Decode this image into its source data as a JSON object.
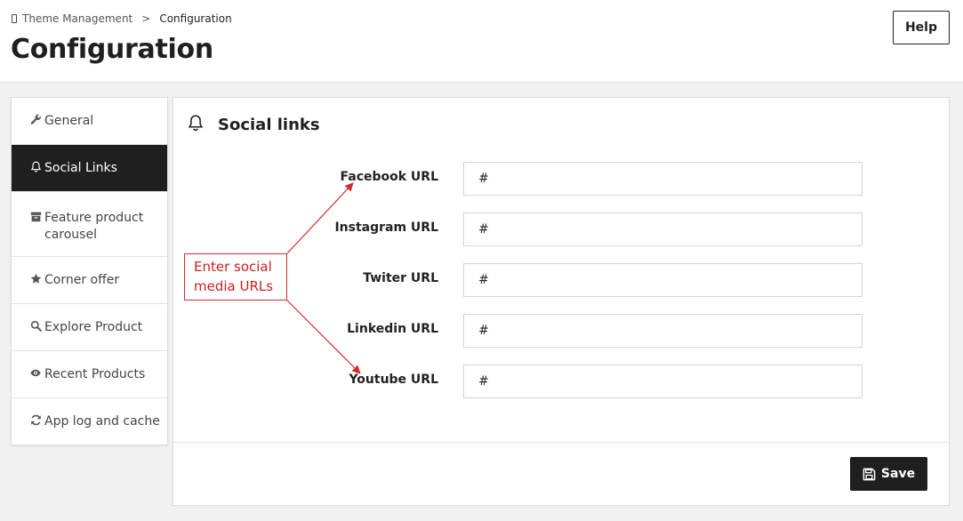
{
  "breadcrumb": {
    "parent": "Theme Management",
    "separator": ">",
    "current": "Configuration"
  },
  "page": {
    "title": "Configuration"
  },
  "header": {
    "help_label": "Help"
  },
  "sidebar": {
    "items": [
      {
        "label": "General",
        "icon": "wrench-icon"
      },
      {
        "label": "Social Links",
        "icon": "bell-icon",
        "active": true
      },
      {
        "label": "Feature product carousel",
        "icon": "archive-icon"
      },
      {
        "label": "Corner offer",
        "icon": "star-icon"
      },
      {
        "label": "Explore Product",
        "icon": "search-icon"
      },
      {
        "label": "Recent Products",
        "icon": "eye-icon"
      },
      {
        "label": "App log and cache",
        "icon": "refresh-icon"
      }
    ]
  },
  "panel": {
    "title": "Social links",
    "icon": "bell-icon",
    "fields": [
      {
        "label": "Facebook URL",
        "value": "#"
      },
      {
        "label": "Instagram URL",
        "value": "#"
      },
      {
        "label": "Twiter URL",
        "value": "#"
      },
      {
        "label": "Linkedin URL",
        "value": "#"
      },
      {
        "label": "Youtube URL",
        "value": "#"
      }
    ],
    "save_label": "Save"
  },
  "annotation": {
    "text": "Enter social media URLs",
    "color": "#d92b2b"
  },
  "colors": {
    "accent": "#1f1f1f",
    "background": "#f1f1f1",
    "annotation": "#d92b2b"
  }
}
